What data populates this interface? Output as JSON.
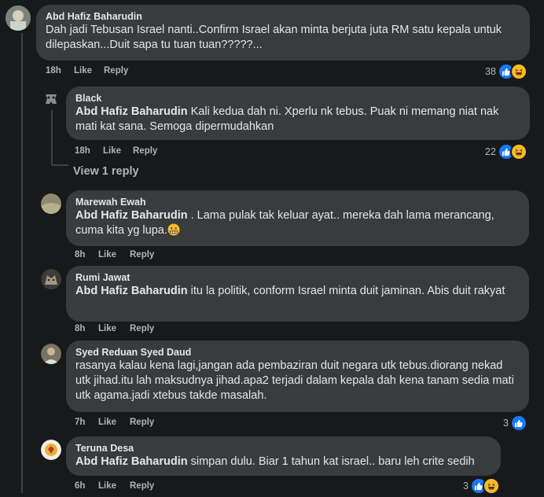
{
  "comments": [
    {
      "author": "Abd Hafiz Baharudin",
      "text": "Dah jadi Tebusan Israel nanti..Confirm Israel akan minta berjuta juta RM satu kepala untuk dilepaskan...Duit sapa tu tuan tuan?????...",
      "time": "18h",
      "like": "Like",
      "reply": "Reply",
      "reactions": "38"
    },
    {
      "author": "Black",
      "mention": "Abd Hafiz Baharudin",
      "text": " Kali kedua dah ni. Xperlu nk tebus. Puak ni memang niat nak mati kat sana. Semoga dipermudahkan",
      "time": "18h",
      "like": "Like",
      "reply": "Reply",
      "reactions": "22"
    },
    {
      "author": "Marewah Ewah",
      "mention": "Abd Hafiz Baharudin",
      "text": " . Lama pulak tak keluar ayat.. mereka dah lama merancang, cuma kita yg lupa.",
      "time": "8h",
      "like": "Like",
      "reply": "Reply"
    },
    {
      "author": "Rumi Jawat",
      "mention": "Abd Hafiz Baharudin",
      "text": " itu la politik, conform Israel minta duit jaminan. Abis duit rakyat",
      "time": "8h",
      "like": "Like",
      "reply": "Reply"
    },
    {
      "author": "Syed Reduan Syed Daud",
      "text": "rasanya kalau kena lagi,jangan ada pembaziran duit negara utk tebus.diorang nekad utk jihad.itu lah maksudnya jihad.apa2 terjadi dalam kepala dah kena tanam sedia mati utk agama.jadi xtebus takde masalah.",
      "time": "7h",
      "like": "Like",
      "reply": "Reply",
      "reactions": "3"
    },
    {
      "author": "Teruna Desa",
      "mention": "Abd Hafiz Baharudin",
      "text": " simpan dulu. Biar 1 tahun kat israel.. baru leh crite sedih",
      "time": "6h",
      "like": "Like",
      "reply": "Reply",
      "reactions": "3"
    }
  ],
  "view_replies": "View 1 reply",
  "colors": {
    "background": "#18191a",
    "bubble": "#3a3b3c",
    "meta": "#b0b3b8",
    "like": "#1877f2",
    "haha": "#f7b928"
  },
  "icons": [
    "like-reaction-icon",
    "haha-reaction-icon",
    "grimace-emoji-icon"
  ]
}
